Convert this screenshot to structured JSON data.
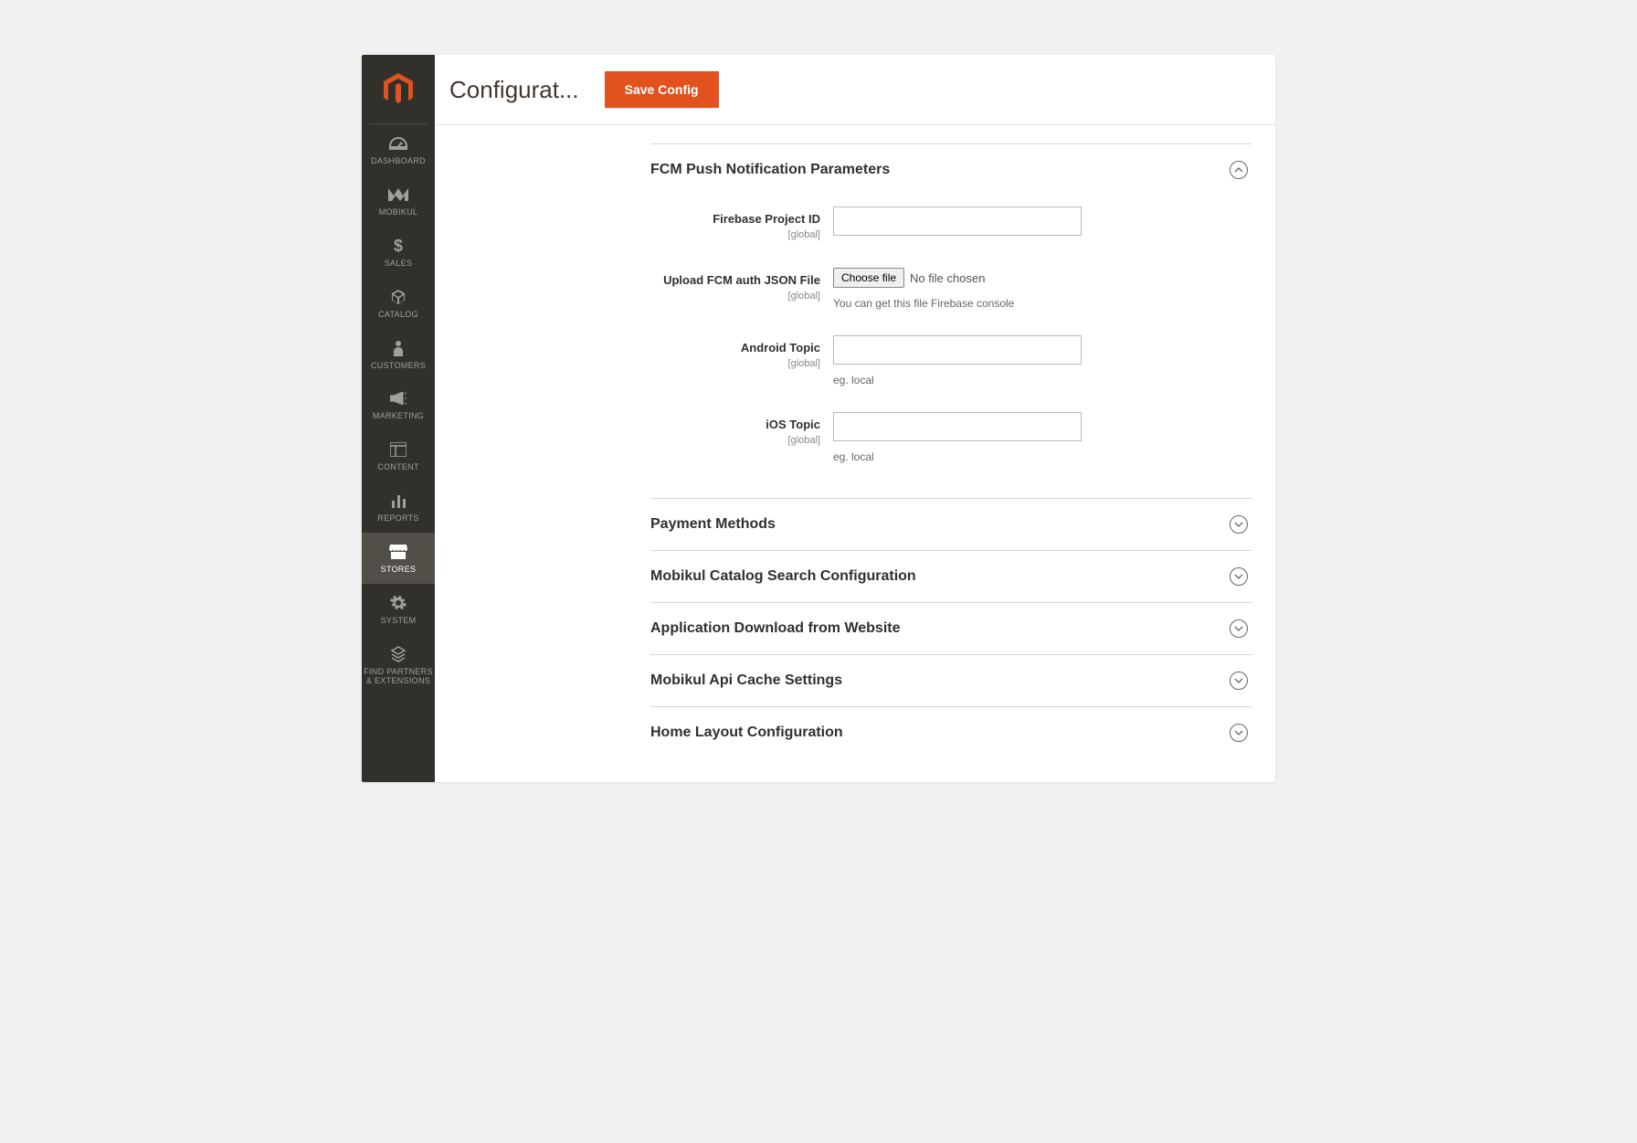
{
  "header": {
    "title": "Configurat...",
    "save_label": "Save Config"
  },
  "sidebar": {
    "items": [
      {
        "label": "DASHBOARD"
      },
      {
        "label": "MOBIKUL"
      },
      {
        "label": "SALES"
      },
      {
        "label": "CATALOG"
      },
      {
        "label": "CUSTOMERS"
      },
      {
        "label": "MARKETING"
      },
      {
        "label": "CONTENT"
      },
      {
        "label": "REPORTS"
      },
      {
        "label": "STORES"
      },
      {
        "label": "SYSTEM"
      },
      {
        "label": "FIND PARTNERS & EXTENSIONS"
      }
    ]
  },
  "scope": "[global]",
  "sections": {
    "fcm": {
      "title": "FCM Push Notification Parameters",
      "fields": {
        "project_id": {
          "label": "Firebase Project ID",
          "value": ""
        },
        "auth_file": {
          "label": "Upload FCM auth JSON File",
          "choose": "Choose file",
          "status": "No file chosen",
          "hint": "You can get this file Firebase console"
        },
        "android": {
          "label": "Android Topic",
          "value": "",
          "hint": "eg. local"
        },
        "ios": {
          "label": "iOS Topic",
          "value": "",
          "hint": "eg. local"
        }
      }
    },
    "collapsed": [
      {
        "title": "Payment Methods"
      },
      {
        "title": "Mobikul Catalog Search Configuration"
      },
      {
        "title": "Application Download from Website"
      },
      {
        "title": "Mobikul Api Cache Settings"
      },
      {
        "title": "Home Layout Configuration"
      }
    ]
  }
}
